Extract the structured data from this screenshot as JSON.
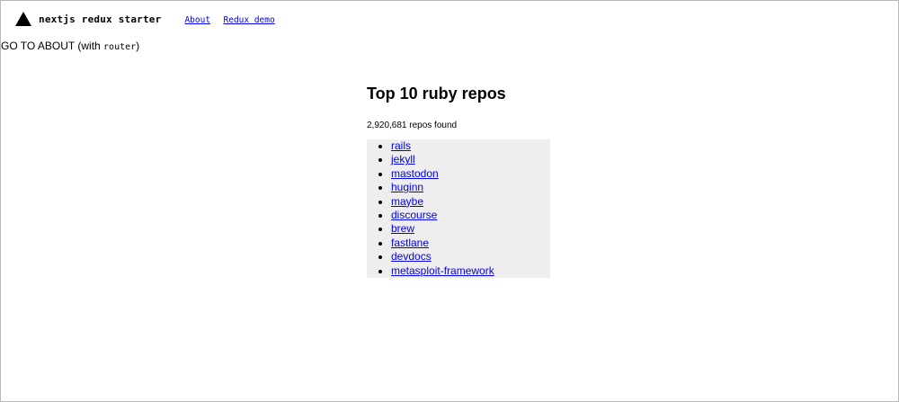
{
  "header": {
    "brand": "nextjs redux starter",
    "logo_icon": "triangle-logo-icon",
    "nav": [
      {
        "label": "About"
      },
      {
        "label": "Redux demo"
      }
    ]
  },
  "goto_about": {
    "text_before": "GO TO ABOUT (with ",
    "code": "router",
    "text_after": ")"
  },
  "main": {
    "title": "Top 10 ruby repos",
    "count_text": "2,920,681 repos found",
    "repos": [
      {
        "name": "rails"
      },
      {
        "name": "jekyll"
      },
      {
        "name": "mastodon"
      },
      {
        "name": "huginn"
      },
      {
        "name": "maybe"
      },
      {
        "name": "discourse"
      },
      {
        "name": "brew"
      },
      {
        "name": "fastlane"
      },
      {
        "name": "devdocs"
      },
      {
        "name": "metasploit-framework"
      }
    ]
  },
  "colors": {
    "link": "#0000ee",
    "list_background": "#eeeeee"
  }
}
